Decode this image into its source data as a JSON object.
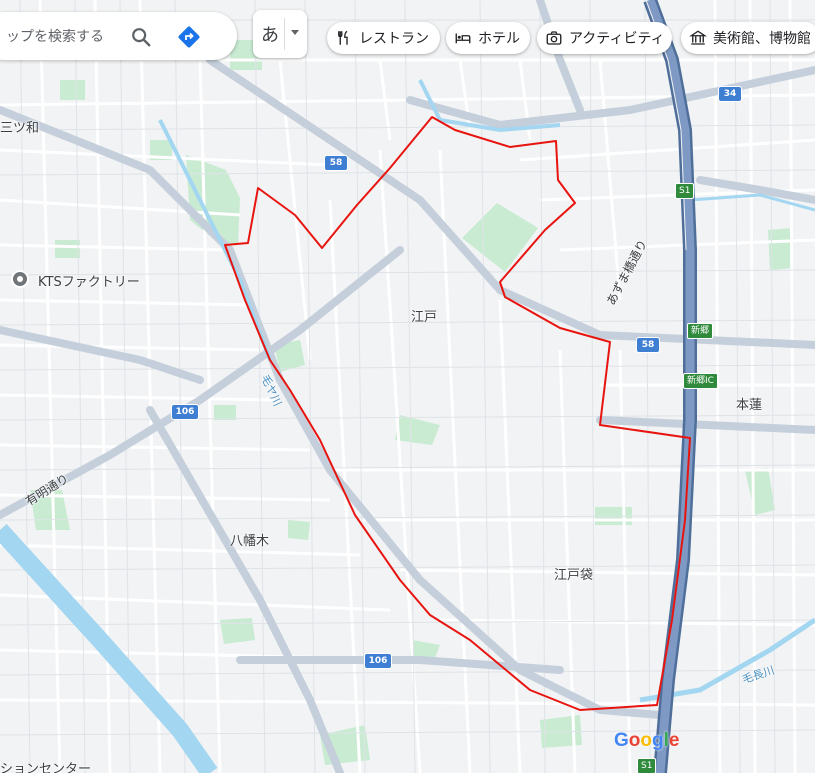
{
  "search": {
    "placeholder": "ップを検索する"
  },
  "ime": {
    "char": "あ"
  },
  "chips": [
    {
      "label": "レストラン",
      "icon": "fork-knife-icon"
    },
    {
      "label": "ホテル",
      "icon": "bed-icon"
    },
    {
      "label": "アクティビティ",
      "icon": "camera-icon"
    },
    {
      "label": "美術館、博物館",
      "icon": "museum-icon"
    }
  ],
  "places": {
    "mitsuwa": "三ツ和",
    "kts": "KTSファクトリー",
    "edo": "江戸",
    "motohasu": "本蓮",
    "yawatagi": "八幡木",
    "edobukuro": "江戸袋",
    "station_center": "ションセンター"
  },
  "roads": {
    "azuma": "あずま橋通り",
    "ariake": "有明通り",
    "kenaga": "毛長川",
    "mouya": "毛ヤ川"
  },
  "shields": {
    "r58_a": "58",
    "r58_b": "58",
    "r106_a": "106",
    "r106_b": "106",
    "r34": "34",
    "s1_a": "S1",
    "s1_b": "S1",
    "shingo": "新郷",
    "shingo_ic": "新郷IC"
  },
  "google_logo": "Google",
  "colors": {
    "boundary": "#e8140f",
    "highway": "#6f8db9",
    "park": "#c8ebd2",
    "water": "#a3d6f0"
  }
}
